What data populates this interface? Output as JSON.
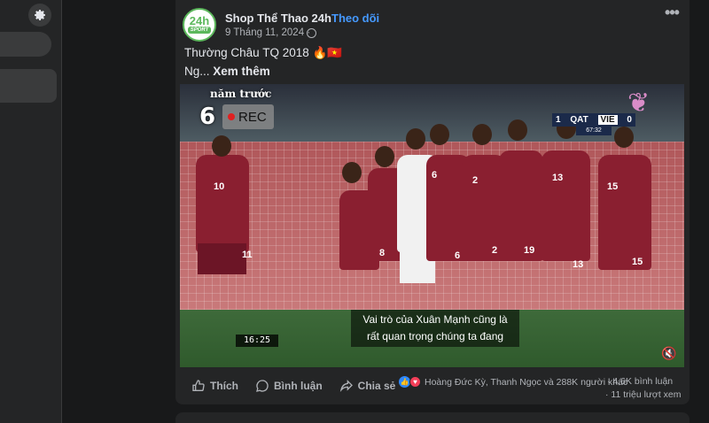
{
  "sidebar": {
    "settings_icon": "gear-icon"
  },
  "post": {
    "avatar_line1": "24h",
    "avatar_line2": "SPORT",
    "page_name": "Shop Thể Thao 24h",
    "separator": "·",
    "follow_label": "Theo dõi",
    "date": "9 Tháng 11, 2024",
    "date_sep": "·",
    "more_label": "•••",
    "caption_line1": "Thường Châu TQ 2018 🔥🇻🇳",
    "caption_prefix": "Ng... ",
    "see_more_label": "Xem thêm"
  },
  "video": {
    "overlay_ago": "năm trước",
    "overlay_number": "6",
    "rec_label": "REC",
    "score": {
      "home_score": "1",
      "home_team": "QAT",
      "away_team": "VIE",
      "away_score": "0",
      "clock": "67:32"
    },
    "subtitle_line1": "Vai trò của Xuân Mạnh cũng là",
    "subtitle_line2": "rất quan trọng chúng ta đang",
    "timestamp": "16:25",
    "jersey_numbers": [
      "10",
      "6",
      "15",
      "2",
      "13",
      "15",
      "8",
      "6",
      "19",
      "13",
      "11",
      "2"
    ],
    "mute_icon": "volume-mute-icon"
  },
  "footer": {
    "like_label": "Thích",
    "comment_label": "Bình luận",
    "share_label": "Chia sẻ",
    "reactions_text": "Hoàng Đức Kỳ, Thanh Ngọc và 288K người khác",
    "comments_text": "· 4,6K bình luận",
    "views_text": "· 11 triệu lượt xem"
  },
  "colors": {
    "accent": "#4599ff",
    "background": "#18191a",
    "card": "#242526",
    "text": "#e4e6eb",
    "secondary": "#b0b3b8"
  }
}
